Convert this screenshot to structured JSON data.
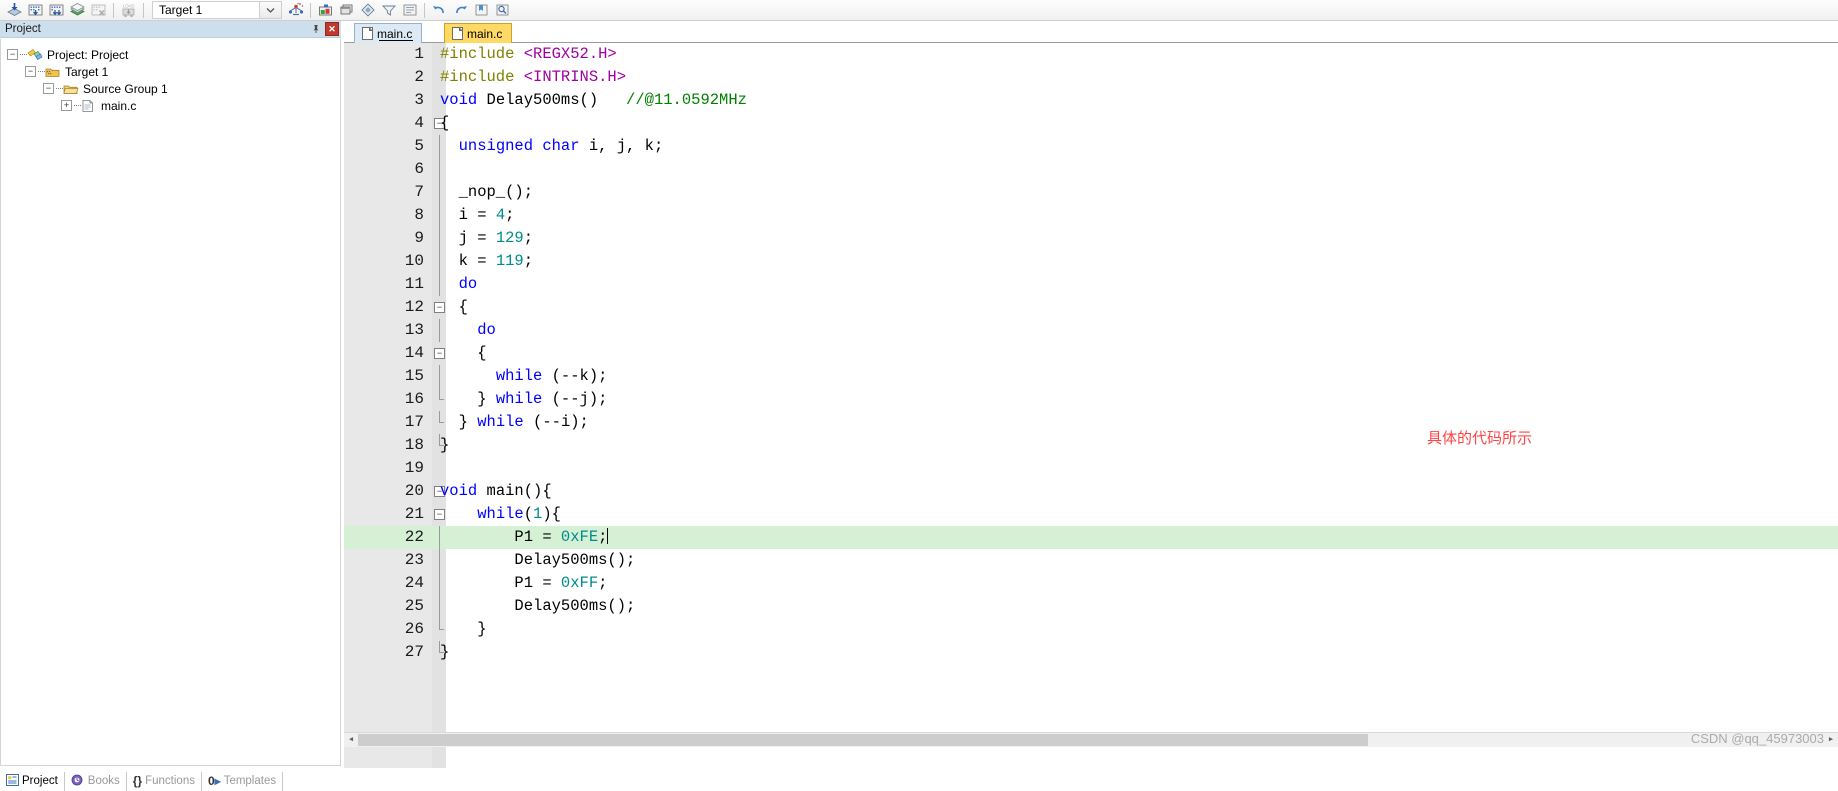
{
  "toolbar": {
    "target_label": "Target 1",
    "buttons": [
      {
        "name": "build-target-icon",
        "title": "Build"
      },
      {
        "name": "rebuild-all-icon",
        "title": "Rebuild all target files"
      },
      {
        "name": "batch-build-icon",
        "title": "Batch Build"
      },
      {
        "name": "translate-file-icon",
        "title": "Translate current file"
      },
      {
        "name": "stop-build-icon",
        "title": "Stop build"
      },
      {
        "name": "download-icon",
        "title": "Download to Flash"
      },
      {
        "name": "target-options-icon",
        "title": "Options for Target"
      },
      {
        "name": "manage-project-items-icon",
        "title": "Manage Project Items"
      },
      {
        "name": "pack-installer-icon",
        "title": "Pack Installer"
      },
      {
        "name": "run-to-cursor-icon",
        "title": "Run"
      },
      {
        "name": "configure-icon",
        "title": "Configure"
      }
    ]
  },
  "project_pane": {
    "title": "Project",
    "pin_icon": "pin-icon",
    "close_icon": "close-icon",
    "tree": [
      {
        "label": "Project: Project",
        "icon": "project-icon",
        "depth": 0,
        "expander": "-"
      },
      {
        "label": "Target 1",
        "icon": "target-icon",
        "depth": 1,
        "expander": "-"
      },
      {
        "label": "Source Group 1",
        "icon": "folder-icon",
        "depth": 2,
        "expander": "-"
      },
      {
        "label": "main.c",
        "icon": "c-file-icon",
        "depth": 3,
        "expander": "+"
      }
    ],
    "bottom_tabs": [
      {
        "label": "Project",
        "icon": "project-tab-icon",
        "active": true
      },
      {
        "label": "Books",
        "icon": "books-icon",
        "active": false
      },
      {
        "label": "Functions",
        "icon": "braces-icon",
        "active": false
      },
      {
        "label": "Templates",
        "icon": "templates-icon",
        "active": false
      }
    ]
  },
  "editor": {
    "tabs": [
      {
        "label": "main.c",
        "active": true,
        "icon": "c-file-icon"
      },
      {
        "label": "main.c",
        "active": false,
        "icon": "c-file-icon"
      }
    ],
    "annotation": "具体的代码所示",
    "watermark": "CSDN @qq_45973003",
    "highlighted_line": 22,
    "lines": [
      {
        "n": 1,
        "fold": "",
        "tokens": [
          {
            "t": "#include ",
            "c": "pp"
          },
          {
            "t": "<REGX52.H>",
            "c": "hdr"
          }
        ]
      },
      {
        "n": 2,
        "fold": "",
        "tokens": [
          {
            "t": "#include ",
            "c": "pp"
          },
          {
            "t": "<INTRINS.H>",
            "c": "hdr"
          }
        ]
      },
      {
        "n": 3,
        "fold": "",
        "tokens": [
          {
            "t": "void ",
            "c": "k"
          },
          {
            "t": "Delay500ms()   ",
            "c": "pl"
          },
          {
            "t": "//@11.0592MHz",
            "c": "cm"
          }
        ]
      },
      {
        "n": 4,
        "fold": "-",
        "tokens": [
          {
            "t": "{",
            "c": "pl"
          }
        ]
      },
      {
        "n": 5,
        "fold": "|",
        "tokens": [
          {
            "t": "  ",
            "c": "pl"
          },
          {
            "t": "unsigned char ",
            "c": "k"
          },
          {
            "t": "i, j, k;",
            "c": "pl"
          }
        ]
      },
      {
        "n": 6,
        "fold": "|",
        "tokens": [
          {
            "t": "",
            "c": "pl"
          }
        ]
      },
      {
        "n": 7,
        "fold": "|",
        "tokens": [
          {
            "t": "  _nop_();",
            "c": "pl"
          }
        ]
      },
      {
        "n": 8,
        "fold": "|",
        "tokens": [
          {
            "t": "  i = ",
            "c": "pl"
          },
          {
            "t": "4",
            "c": "num"
          },
          {
            "t": ";",
            "c": "pl"
          }
        ]
      },
      {
        "n": 9,
        "fold": "|",
        "tokens": [
          {
            "t": "  j = ",
            "c": "pl"
          },
          {
            "t": "129",
            "c": "num"
          },
          {
            "t": ";",
            "c": "pl"
          }
        ]
      },
      {
        "n": 10,
        "fold": "|",
        "tokens": [
          {
            "t": "  k = ",
            "c": "pl"
          },
          {
            "t": "119",
            "c": "num"
          },
          {
            "t": ";",
            "c": "pl"
          }
        ]
      },
      {
        "n": 11,
        "fold": "|",
        "tokens": [
          {
            "t": "  ",
            "c": "pl"
          },
          {
            "t": "do",
            "c": "k"
          }
        ]
      },
      {
        "n": 12,
        "fold": "-",
        "tokens": [
          {
            "t": "  {",
            "c": "pl"
          }
        ]
      },
      {
        "n": 13,
        "fold": "|",
        "tokens": [
          {
            "t": "    ",
            "c": "pl"
          },
          {
            "t": "do",
            "c": "k"
          }
        ]
      },
      {
        "n": 14,
        "fold": "-",
        "tokens": [
          {
            "t": "    {",
            "c": "pl"
          }
        ]
      },
      {
        "n": 15,
        "fold": "|",
        "tokens": [
          {
            "t": "      ",
            "c": "pl"
          },
          {
            "t": "while",
            "c": "k"
          },
          {
            "t": " (--k);",
            "c": "pl"
          }
        ]
      },
      {
        "n": 16,
        "fold": "L",
        "tokens": [
          {
            "t": "    } ",
            "c": "pl"
          },
          {
            "t": "while",
            "c": "k"
          },
          {
            "t": " (--j);",
            "c": "pl"
          }
        ]
      },
      {
        "n": 17,
        "fold": "L",
        "tokens": [
          {
            "t": "  } ",
            "c": "pl"
          },
          {
            "t": "while",
            "c": "k"
          },
          {
            "t": " (--i);",
            "c": "pl"
          }
        ]
      },
      {
        "n": 18,
        "fold": "L",
        "tokens": [
          {
            "t": "}",
            "c": "pl"
          }
        ]
      },
      {
        "n": 19,
        "fold": "",
        "tokens": [
          {
            "t": "",
            "c": "pl"
          }
        ]
      },
      {
        "n": 20,
        "fold": "-",
        "tokens": [
          {
            "t": "void ",
            "c": "k"
          },
          {
            "t": "main(){",
            "c": "pl"
          }
        ]
      },
      {
        "n": 21,
        "fold": "-",
        "tokens": [
          {
            "t": "    ",
            "c": "pl"
          },
          {
            "t": "while",
            "c": "k"
          },
          {
            "t": "(",
            "c": "pl"
          },
          {
            "t": "1",
            "c": "num"
          },
          {
            "t": "){",
            "c": "pl"
          }
        ]
      },
      {
        "n": 22,
        "fold": "|",
        "tokens": [
          {
            "t": "        P1 = ",
            "c": "pl"
          },
          {
            "t": "0xFE",
            "c": "num"
          },
          {
            "t": ";",
            "c": "pl"
          }
        ]
      },
      {
        "n": 23,
        "fold": "|",
        "tokens": [
          {
            "t": "        Delay500ms();",
            "c": "pl"
          }
        ]
      },
      {
        "n": 24,
        "fold": "|",
        "tokens": [
          {
            "t": "        P1 = ",
            "c": "pl"
          },
          {
            "t": "0xFF",
            "c": "num"
          },
          {
            "t": ";",
            "c": "pl"
          }
        ]
      },
      {
        "n": 25,
        "fold": "|",
        "tokens": [
          {
            "t": "        Delay500ms();",
            "c": "pl"
          }
        ]
      },
      {
        "n": 26,
        "fold": "L",
        "tokens": [
          {
            "t": "    }",
            "c": "pl"
          }
        ]
      },
      {
        "n": 27,
        "fold": "L",
        "tokens": [
          {
            "t": "}",
            "c": "pl"
          }
        ]
      }
    ],
    "scrollbar": {
      "left_arrow": "◀",
      "right_arrow": "▶"
    }
  },
  "colors": {
    "keyword": "#0000ff",
    "preprocessor": "#808000",
    "header": "#a000a0",
    "number": "#008b8b",
    "comment": "#008000",
    "highlight_line": "#d6f0d6",
    "annotation": "#ff4444",
    "pane_header": "#cddeed"
  }
}
